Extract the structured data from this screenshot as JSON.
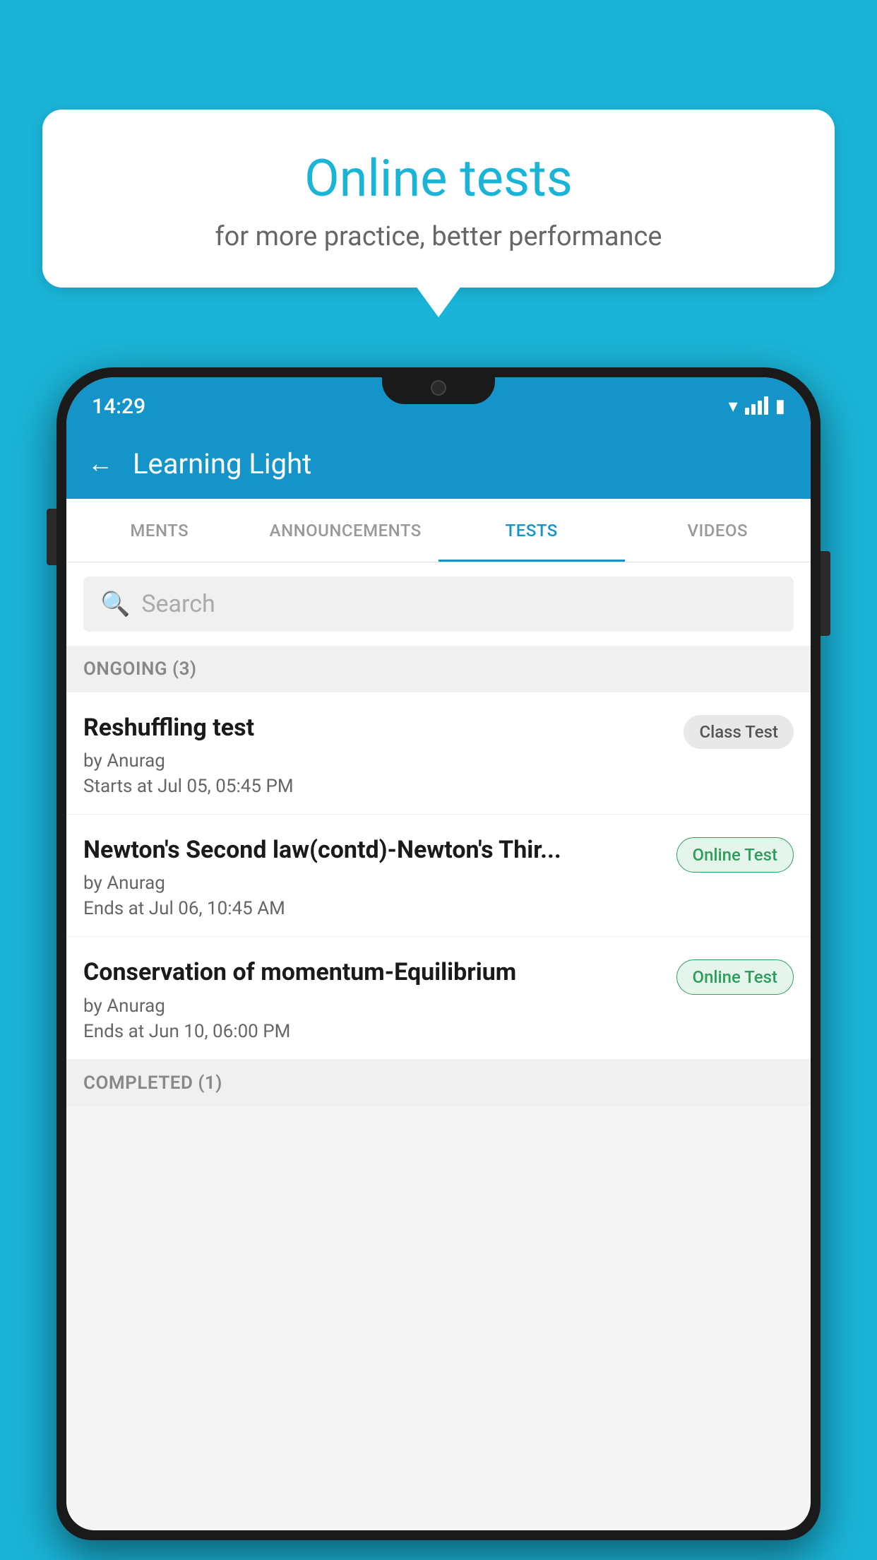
{
  "background_color": "#1ab4d8",
  "bubble": {
    "title": "Online tests",
    "subtitle": "for more practice, better performance"
  },
  "phone": {
    "status_bar": {
      "time": "14:29",
      "wifi": "▾",
      "signal": [
        40,
        60,
        80,
        100
      ],
      "battery": "▮"
    },
    "header": {
      "back_label": "←",
      "title": "Learning Light"
    },
    "tabs": [
      {
        "label": "MENTS",
        "active": false
      },
      {
        "label": "ANNOUNCEMENTS",
        "active": false
      },
      {
        "label": "TESTS",
        "active": true
      },
      {
        "label": "VIDEOS",
        "active": false
      }
    ],
    "search": {
      "placeholder": "Search"
    },
    "ongoing_section": {
      "label": "ONGOING (3)"
    },
    "tests": [
      {
        "title": "Reshuffling test",
        "author": "by Anurag",
        "time": "Starts at  Jul 05, 05:45 PM",
        "badge": "Class Test",
        "badge_type": "class"
      },
      {
        "title": "Newton's Second law(contd)-Newton's Thir...",
        "author": "by Anurag",
        "time": "Ends at  Jul 06, 10:45 AM",
        "badge": "Online Test",
        "badge_type": "online"
      },
      {
        "title": "Conservation of momentum-Equilibrium",
        "author": "by Anurag",
        "time": "Ends at  Jun 10, 06:00 PM",
        "badge": "Online Test",
        "badge_type": "online"
      }
    ],
    "completed_section": {
      "label": "COMPLETED (1)"
    }
  }
}
